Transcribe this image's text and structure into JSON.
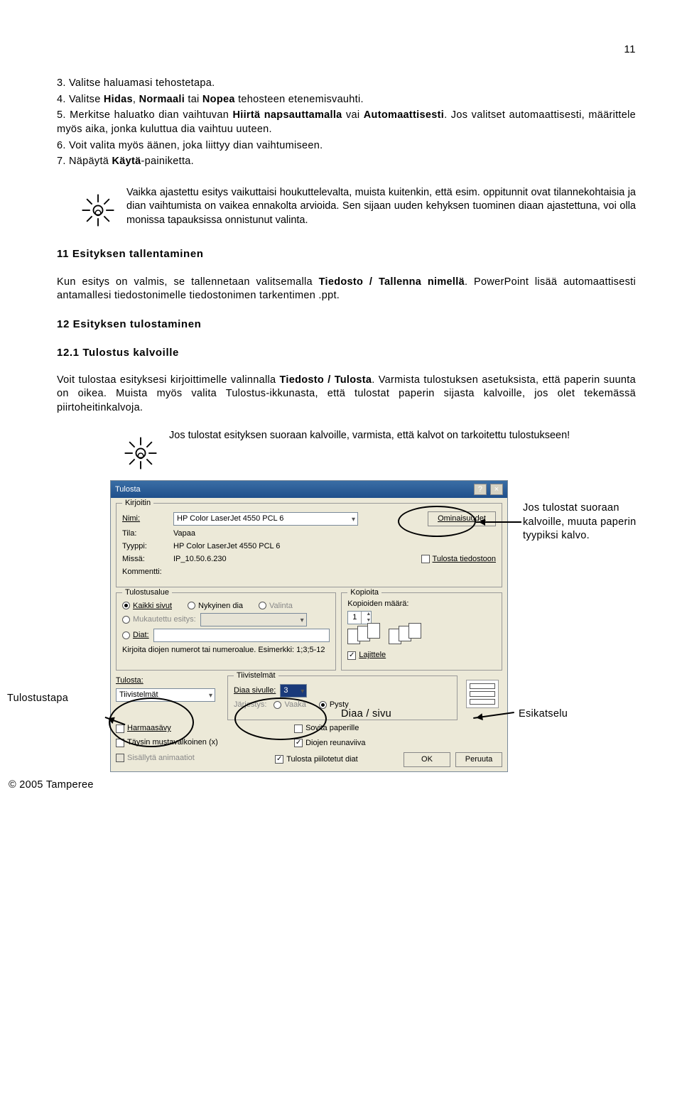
{
  "page_number": "11",
  "steps": [
    {
      "n": "3.",
      "t": "Valitse haluamasi tehostetapa."
    },
    {
      "n": "4.",
      "pre": "Valitse ",
      "b": "Hidas",
      "mid": ", ",
      "b2": "Normaali",
      "mid2": " tai ",
      "b3": "Nopea",
      "post": " tehosteen etenemisvauhti."
    },
    {
      "n": "5.",
      "pre": "Merkitse haluatko dian vaihtuvan ",
      "b": "Hiirtä napsauttamalla",
      "mid": " vai ",
      "b2": "Automaattisesti",
      "post": ". Jos valitset automaattisesti, määrittele myös aika, jonka kuluttua dia vaihtuu uuteen."
    },
    {
      "n": "6.",
      "t": "Voit valita myös äänen, joka liittyy dian vaihtumiseen."
    },
    {
      "n": "7.",
      "pre": "Näpäytä ",
      "b": "Käytä",
      "post": "-painiketta."
    }
  ],
  "tip1": "Vaikka ajastettu esitys vaikuttaisi houkuttelevalta, muista kuitenkin, että esim. oppitunnit ovat tilannekohtaisia ja dian vaihtumista on vaikea ennakolta arvioida. Sen sijaan uuden kehyksen tuominen diaan ajastettuna, voi olla monissa tapauksissa onnistunut valinta.",
  "h11": "11 Esityksen tallentaminen",
  "p11": {
    "pre": "Kun esitys on valmis, se tallennetaan valitsemalla ",
    "b": "Tiedosto / Tallenna nimellä",
    "post": ". PowerPoint lisää automaattisesti antamallesi tiedostonimelle tiedostonimen tarkentimen .ppt."
  },
  "h12": "12 Esityksen tulostaminen",
  "h121": "12.1 Tulostus kalvoille",
  "p12": {
    "pre": "Voit tulostaa esityksesi kirjoittimelle valinnalla ",
    "b": "Tiedosto / Tulosta",
    "post": ". Varmista tulostuksen asetuksista, että paperin suunta on oikea. Muista myös valita Tulostus-ikkunasta, että tulostat paperin sijasta kalvoille, jos olet tekemässä piirtoheitinkalvoja."
  },
  "tip2": "Jos tulostat esityksen suoraan kalvoille, varmista, että kalvot on tarkoitettu tulostukseen!",
  "dlg": {
    "title": "Tulosta",
    "g_printer": "Kirjoitin",
    "lab_name": "Nimi:",
    "val_name": "HP Color LaserJet 4550 PCL 6",
    "lab_state": "Tila:",
    "val_state": "Vapaa",
    "lab_type": "Tyyppi:",
    "val_type": "HP Color LaserJet 4550 PCL 6",
    "lab_where": "Missä:",
    "val_where": "IP_10.50.6.230",
    "lab_comment": "Kommentti:",
    "btn_props": "Ominaisuudet",
    "chk_tofile": "Tulosta tiedostoon",
    "g_range": "Tulostusalue",
    "r_all": "Kaikki sivut",
    "r_cur": "Nykyinen dia",
    "r_sel": "Valinta",
    "r_custom": "Mukautettu esitys:",
    "r_dias": "Diat:",
    "range_hint": "Kirjoita diojen numerot tai numeroalue. Esimerkki: 1;3;5-12",
    "g_copies": "Kopioita",
    "lab_copies": "Kopioiden määrä:",
    "val_copies": "1",
    "chk_collate": "Lajittele",
    "lab_print": "Tulosta:",
    "val_print": "Tiivistelmät",
    "lab_summary": "Tiivistelmät",
    "lab_perpage": "Diaa sivulle:",
    "val_perpage": "3",
    "lab_order": "Järjestys:",
    "r_horiz": "Vaaka",
    "r_vert": "Pysty",
    "chk_gray": "Harmaasävy",
    "chk_fit": "Sovita paperille",
    "chk_bw": "Täysin mustavalkoinen (x)",
    "chk_frame": "Diojen reunaviiva",
    "chk_anim": "Sisällytä animaatiot",
    "chk_hidden": "Tulosta piilotetut diat",
    "btn_ok": "OK",
    "btn_cancel": "Peruuta"
  },
  "anno": {
    "right1": "Jos tulostat suoraan kalvoille, muuta paperin tyypiksi kalvo.",
    "left": "Tulostustapa",
    "mid": "Diaa / sivu",
    "right2": "Esikatselu"
  },
  "copyright": "© 2005 Tamperee"
}
